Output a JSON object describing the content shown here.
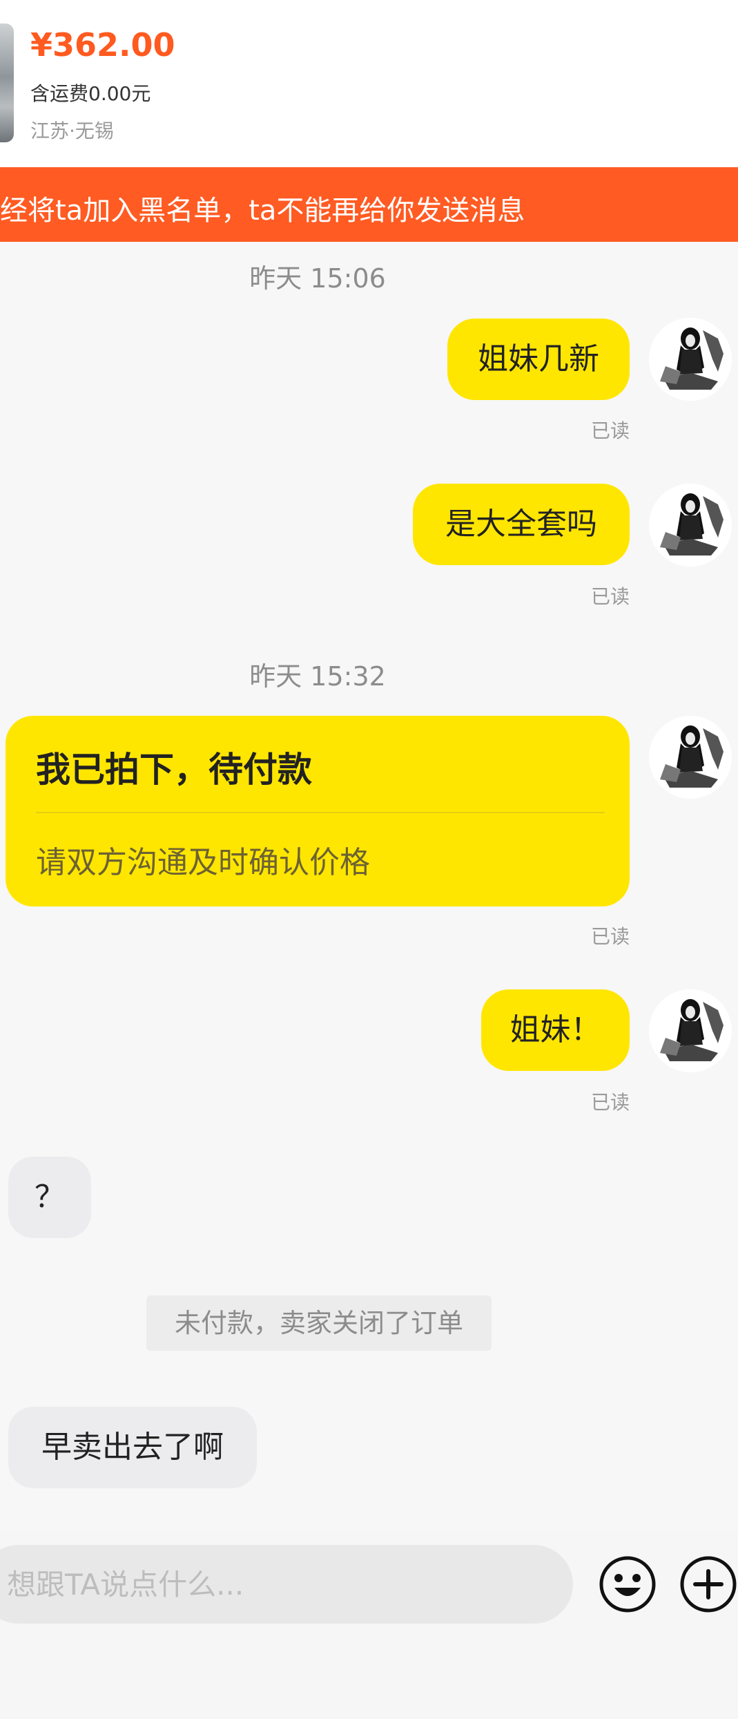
{
  "product": {
    "price": "¥362.00",
    "shipping": "含运费0.00元",
    "location": "江苏·无锡"
  },
  "banner": {
    "text": "经将ta加入黑名单，ta不能再给你发送消息"
  },
  "messages": {
    "time_1": "昨天 15:06",
    "msg_1": "姐妹几新",
    "read_1": "已读",
    "msg_2": "是大全套吗",
    "read_2": "已读",
    "time_2": "昨天 15:32",
    "order_card": {
      "title": "我已拍下，待付款",
      "subtitle": "请双方沟通及时确认价格"
    },
    "read_3": "已读",
    "msg_3": "姐妹！",
    "read_4": "已读",
    "reply_1": "？",
    "system_notice": "未付款，卖家关闭了订单",
    "reply_2": "早卖出去了啊"
  },
  "input": {
    "placeholder": "想跟TA说点什么..."
  },
  "icons": {
    "emoji": "smiley-icon",
    "add": "plus-circle-icon",
    "avatar": "avatar-image"
  },
  "colors": {
    "price": "#ff5a1f",
    "banner": "#ff5b23",
    "bubble_me": "#ffe600",
    "bubble_other": "#ececee"
  }
}
